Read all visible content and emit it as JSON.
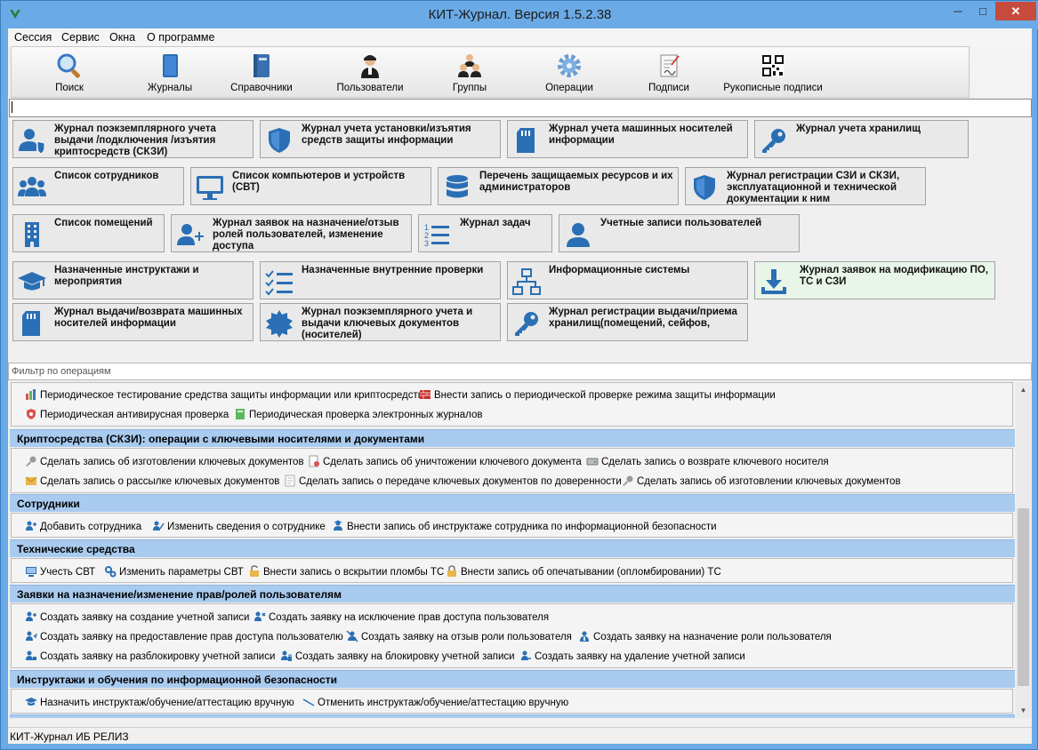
{
  "window": {
    "title": "КИТ-Журнал. Версия 1.5.2.38",
    "min_glyph": "─",
    "max_glyph": "□",
    "close_glyph": "✕"
  },
  "menu": [
    "Сессия",
    "Сервис",
    "Окна",
    "О программе"
  ],
  "toolbar": [
    {
      "label": "Поиск",
      "icon": "magnifier-icon"
    },
    {
      "label": "Журналы",
      "icon": "book-icon"
    },
    {
      "label": "Справочники",
      "icon": "reference-book-icon"
    },
    {
      "label": "Пользователи",
      "icon": "user-icon"
    },
    {
      "label": "Группы",
      "icon": "group-icon"
    },
    {
      "label": "Операции",
      "icon": "gear-icon"
    },
    {
      "label": "Подписи",
      "icon": "signature-icon"
    },
    {
      "label": "Рукописные подписи",
      "icon": "qr-code-icon"
    }
  ],
  "search": {
    "value": ""
  },
  "tiles": [
    {
      "label": "Журнал поэкземплярного учета выдачи /подключения /изъятия криптосредств (СКЗИ)",
      "icon": "user-shield-icon"
    },
    {
      "label": "Журнал учета установки/изъятия средств защиты информации",
      "icon": "shield-icon"
    },
    {
      "label": "Журнал учета машинных носителей информации",
      "icon": "sd-card-icon"
    },
    {
      "label": "Журнал учета хранилищ",
      "icon": "key-icon"
    },
    {
      "label": "Список сотрудников",
      "icon": "users-icon"
    },
    {
      "label": "Список компьютеров и устройств (СВТ)",
      "icon": "monitor-icon"
    },
    {
      "label": "Перечень защищаемых ресурсов и их администраторов",
      "icon": "database-icon"
    },
    {
      "label": "Журнал регистрации СЗИ и СКЗИ, эксплуатационной и технической документации к ним",
      "icon": "shield-icon"
    },
    {
      "label": "Список помещений",
      "icon": "building-icon"
    },
    {
      "label": "Журнал заявок на назначение/отзыв ролей пользователей, изменение доступа",
      "icon": "user-plus-icon"
    },
    {
      "label": "Журнал задач",
      "icon": "task-list-icon"
    },
    {
      "label": "Учетные записи пользователей",
      "icon": "user-icon"
    },
    {
      "label": "Назначенные инструктажи и мероприятия",
      "icon": "graduation-cap-icon"
    },
    {
      "label": "Назначенные внутренние проверки",
      "icon": "checklist-icon"
    },
    {
      "label": "Информационные системы",
      "icon": "network-icon"
    },
    {
      "label": "Журнал заявок на модификацию ПО, ТС и СЗИ",
      "icon": "download-icon"
    },
    {
      "label": "Журнал выдачи/возврата машинных носителей информации",
      "icon": "sd-card-icon"
    },
    {
      "label": "Журнал поэкземплярного учета и выдачи ключевых документов (носителей)",
      "icon": "certificate-seal-icon"
    },
    {
      "label": "Журнал регистрации выдачи/приема хранилищ(помещений, сейфов,",
      "icon": "key-icon"
    }
  ],
  "filter": {
    "placeholder": "Фильтр по операциям"
  },
  "groups": [
    {
      "title": "",
      "ops": [
        [
          "Периодическое тестирование средства защиты информации или криптосредств",
          "Внести запись о периодической проверке режима защиты информации"
        ],
        [
          "Периодическая антивирусная проверка",
          "Периодическая проверка электронных журналов"
        ]
      ]
    },
    {
      "title": "Криптосредства (СКЗИ): операции с ключевыми носителями и документами",
      "ops": [
        [
          "Сделать запись об изготовлении ключевых документов",
          "Сделать запись об уничтожении ключевого документа",
          "Сделать запись о возврате ключевого носителя"
        ],
        [
          "Сделать запись о рассылке ключевых документов",
          "Сделать запись о передаче ключевых документов по доверенности",
          "Сделать запись об изготовлении ключевых документов"
        ]
      ]
    },
    {
      "title": "Сотрудники",
      "ops": [
        [
          "Добавить сотрудника",
          "Изменить сведения о сотруднике",
          "Внести запись об инструктаже сотрудника по информационной безопасности"
        ]
      ]
    },
    {
      "title": "Технические средства",
      "ops": [
        [
          "Учесть СВТ",
          "Изменить параметры СВТ",
          "Внести запись о вскрытии пломбы ТС",
          "Внести запись об опечатывании (опломбировании) ТС"
        ]
      ]
    },
    {
      "title": "Заявки на назначение/изменение прав/ролей пользователям",
      "ops": [
        [
          "Создать заявку на создание учетной записи",
          "Создать заявку на исключение прав доступа пользователя"
        ],
        [
          "Создать заявку на предоставление прав доступа пользователю",
          "Создать заявку на отзыв роли пользователя",
          "Создать заявку на назначение роли пользователя"
        ],
        [
          "Создать заявку на разблокировку учетной записи",
          "Создать заявку на блокировку учетной записи",
          "Создать заявку на удаление учетной записи"
        ]
      ]
    },
    {
      "title": "Инструктажи и обучения по информационной безопасности",
      "ops": [
        [
          "Назначить инструктаж/обучение/аттестацию вручную",
          "Отменить инструктаж/обучение/аттестацию вручную"
        ]
      ]
    }
  ],
  "status": "КИТ-Журнал ИБ РЕЛИЗ",
  "colors": {
    "accent": "#2a6fb5",
    "group_header": "#a9cbef",
    "titlebar": "#6aaae6"
  }
}
